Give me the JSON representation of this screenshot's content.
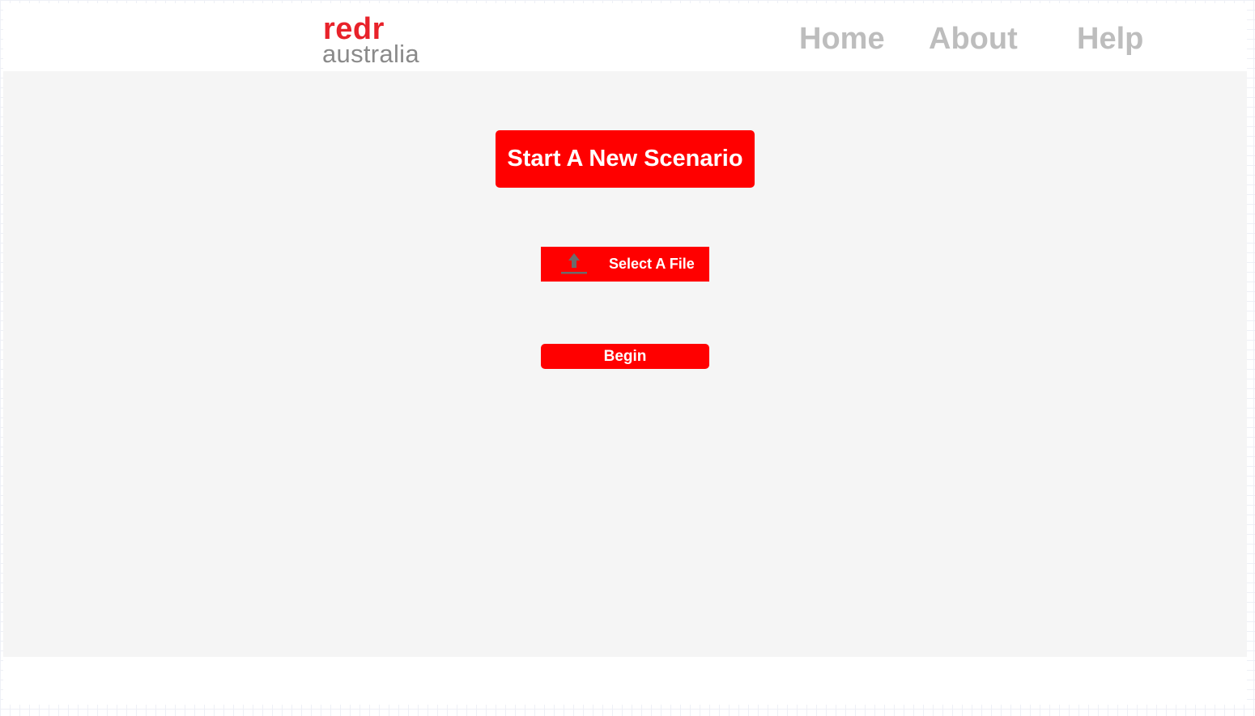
{
  "header": {
    "logo": {
      "primary": "redr",
      "secondary": "australia"
    },
    "nav": {
      "home": "Home",
      "about": "About",
      "help": "Help"
    }
  },
  "main": {
    "start_button": "Start A New Scenario",
    "file_button": {
      "icon": "upload-icon",
      "label": "Select A File"
    },
    "begin_button": "Begin"
  },
  "colors": {
    "accent": "#ff0000",
    "logo_red": "#e8222a",
    "logo_grey": "#8a8a8a",
    "nav_text": "#bdbdbd",
    "panel_bg": "#f5f5f5"
  }
}
